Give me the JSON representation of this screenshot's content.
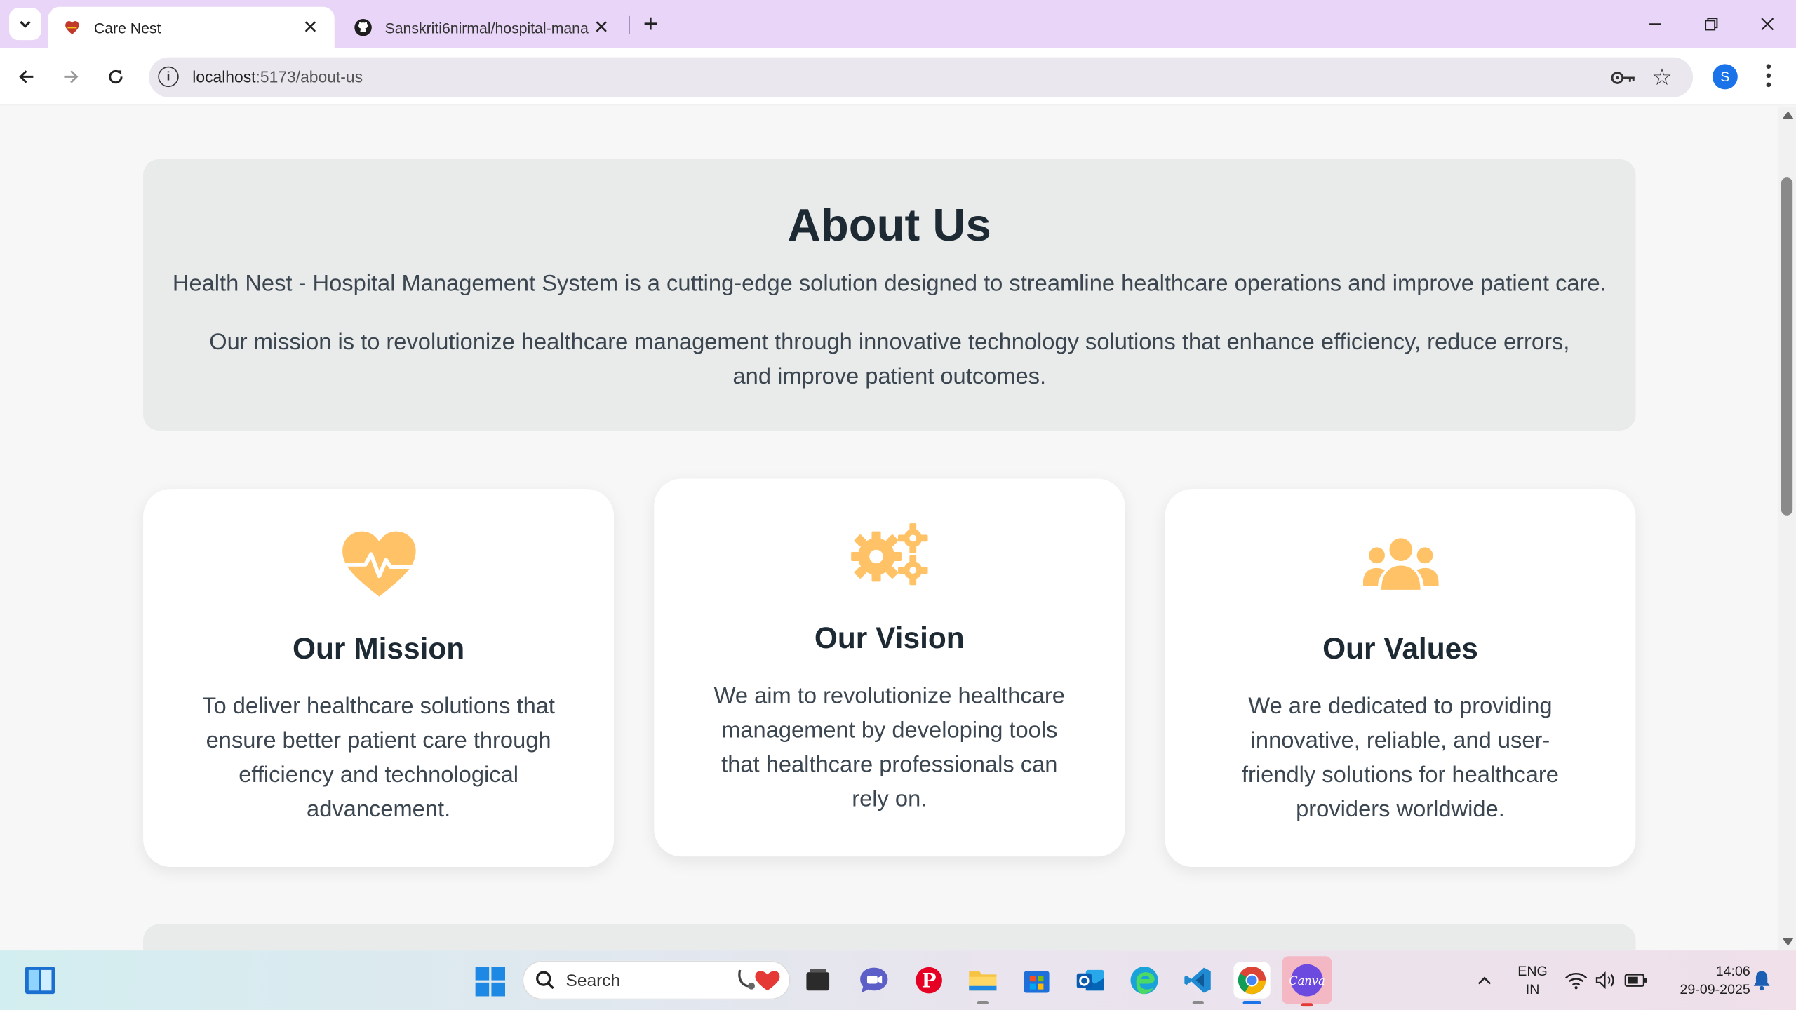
{
  "browser": {
    "tabs": [
      {
        "title": "Care Nest",
        "active": true,
        "favicon": "care-nest-logo-icon"
      },
      {
        "title": "Sanskriti6nirmal/hospital-mana",
        "active": false,
        "favicon": "github-icon"
      }
    ],
    "url_host": "localhost",
    "url_path": ":5173/about-us",
    "profile_initial": "S"
  },
  "about": {
    "title": "About Us",
    "intro": "Health Nest - Hospital Management System is a cutting-edge solution designed to streamline healthcare operations and improve patient care.",
    "mission_statement": "Our mission is to revolutionize healthcare management through innovative technology solutions that enhance efficiency, reduce errors, and improve patient outcomes."
  },
  "cards": [
    {
      "title": "Our Mission",
      "icon": "heartbeat-icon",
      "text": "To deliver healthcare solutions that ensure better patient care through efficiency and technological advancement."
    },
    {
      "title": "Our Vision",
      "icon": "gears-icon",
      "text": "We aim to revolutionize healthcare management by developing tools that healthcare professionals can rely on."
    },
    {
      "title": "Our Values",
      "icon": "users-icon",
      "text": "We are dedicated to providing innovative, reliable, and user-friendly solutions for healthcare providers worldwide."
    }
  ],
  "colors": {
    "accent_icon": "#ffc266",
    "tab_strip": "#e9d5f7",
    "heading": "#1e2a33",
    "body_text": "#3b4650"
  },
  "taskbar": {
    "search_label": "Search",
    "language": "ENG",
    "region": "IN",
    "time": "14:06",
    "date": "29-09-2025"
  }
}
